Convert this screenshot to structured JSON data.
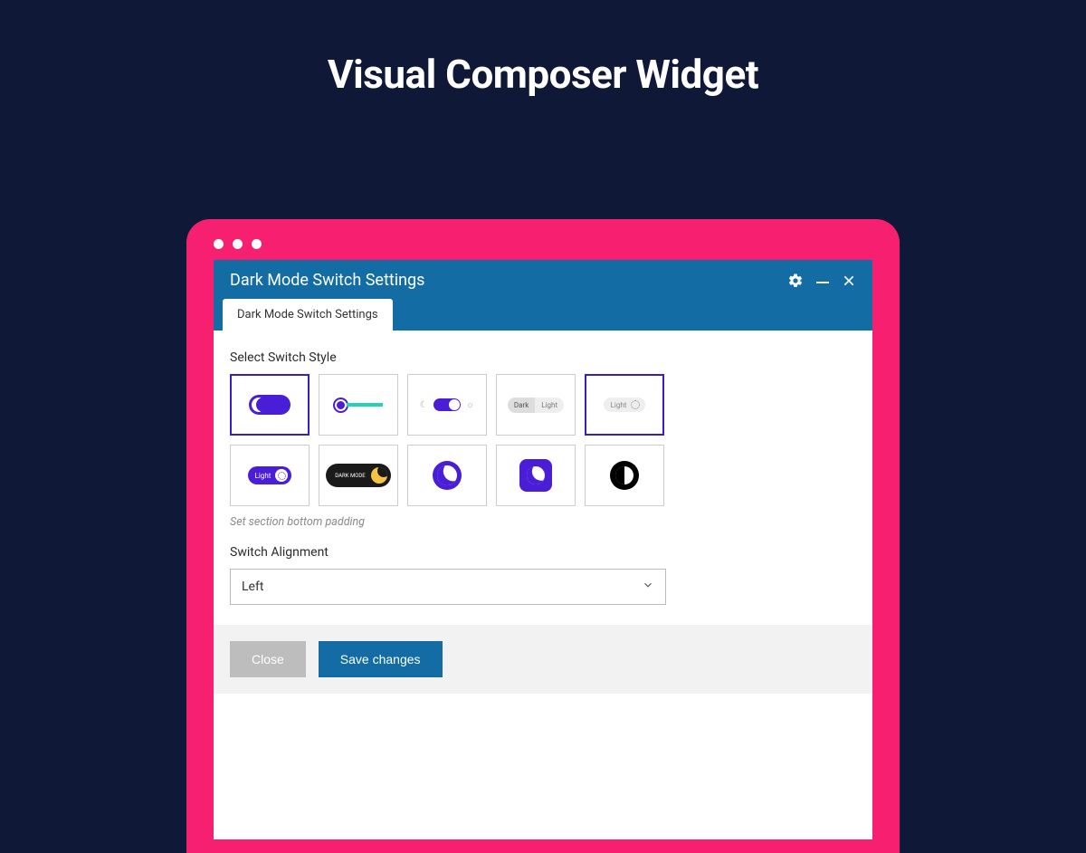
{
  "page": {
    "title": "Visual Composer Widget"
  },
  "modal": {
    "title": "Dark Mode Switch Settings",
    "tab_label": "Dark Mode Switch Settings",
    "fields": {
      "style_label": "Select Switch Style",
      "style_hint": "Set section bottom padding",
      "alignment_label": "Switch Alignment",
      "alignment_value": "Left"
    },
    "switch_labels": {
      "dark": "Dark",
      "light": "Light",
      "dark_mode": "DARK MODE"
    },
    "selected_style_index": 4,
    "footer": {
      "close": "Close",
      "save": "Save changes"
    }
  }
}
